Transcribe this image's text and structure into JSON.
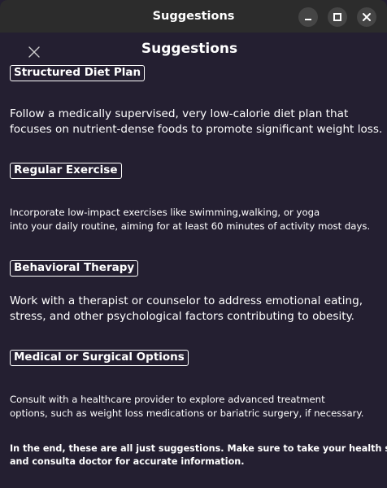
{
  "window": {
    "title": "Suggestions",
    "minimize_icon": "minimize-icon",
    "maximize_icon": "maximize-icon",
    "close_icon": "close-icon"
  },
  "dialog": {
    "title": "Suggestions",
    "close_icon": "close-x-icon"
  },
  "sections": [
    {
      "heading": "Structured Diet Plan",
      "lines": [
        "Follow a medically supervised, very low-calorie diet plan that",
        "focuses on nutrient-dense foods to promote significant weight loss."
      ]
    },
    {
      "heading": "Regular Exercise",
      "lines": [
        "Incorporate low-impact exercises like swimming,walking, or yoga",
        "into your daily routine, aiming for at least 60 minutes of activity most days."
      ]
    },
    {
      "heading": "Behavioral Therapy",
      "lines": [
        "Work with a therapist or counselor to address emotional eating,",
        "stress, and other psychological factors contributing to obesity."
      ]
    },
    {
      "heading": "Medical or Surgical Options",
      "lines": [
        "Consult with a healthcare provider to explore advanced treatment",
        "options, such as weight loss medications or bariatric surgery, if necessary."
      ]
    }
  ],
  "footer": {
    "lines": [
      "In the end, these are all just suggestions. Make sure to take your health seriously",
      "and consulta doctor for accurate information."
    ]
  },
  "colors": {
    "background": "#241f31",
    "titlebar": "#2c2c2c",
    "text": "#ffffff"
  }
}
